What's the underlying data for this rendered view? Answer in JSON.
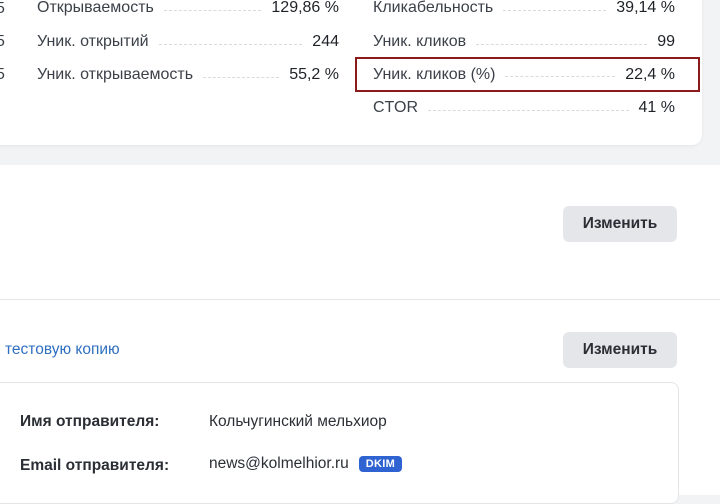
{
  "stats": {
    "left_stub": [
      "5",
      "5",
      "5"
    ],
    "left": [
      {
        "label": "Открываемость",
        "value": "129,86 %"
      },
      {
        "label": "Уник. открытий",
        "value": "244"
      },
      {
        "label": "Уник. открываемость",
        "value": "55,2 %"
      }
    ],
    "right": [
      {
        "label": "Кликабельность",
        "value": "39,14 %"
      },
      {
        "label": "Уник. кликов",
        "value": "99"
      },
      {
        "label": "Уник. кликов (%)",
        "value": "22,4 %"
      },
      {
        "label": "CTOR",
        "value": "41 %"
      }
    ]
  },
  "section1": {
    "edit_label": "Изменить"
  },
  "section2": {
    "link_text": "тестовую копию",
    "edit_label": "Изменить",
    "sender_name_label": "Имя отправителя:",
    "sender_name_value": "Кольчугинский мельхиор",
    "sender_email_label": "Email отправителя:",
    "sender_email_value": "news@kolmelhior.ru",
    "dkim_badge": "DKIM"
  },
  "colors": {
    "highlight_border": "#8b1a1a",
    "link": "#2f6fc0",
    "badge": "#2f63d1"
  }
}
